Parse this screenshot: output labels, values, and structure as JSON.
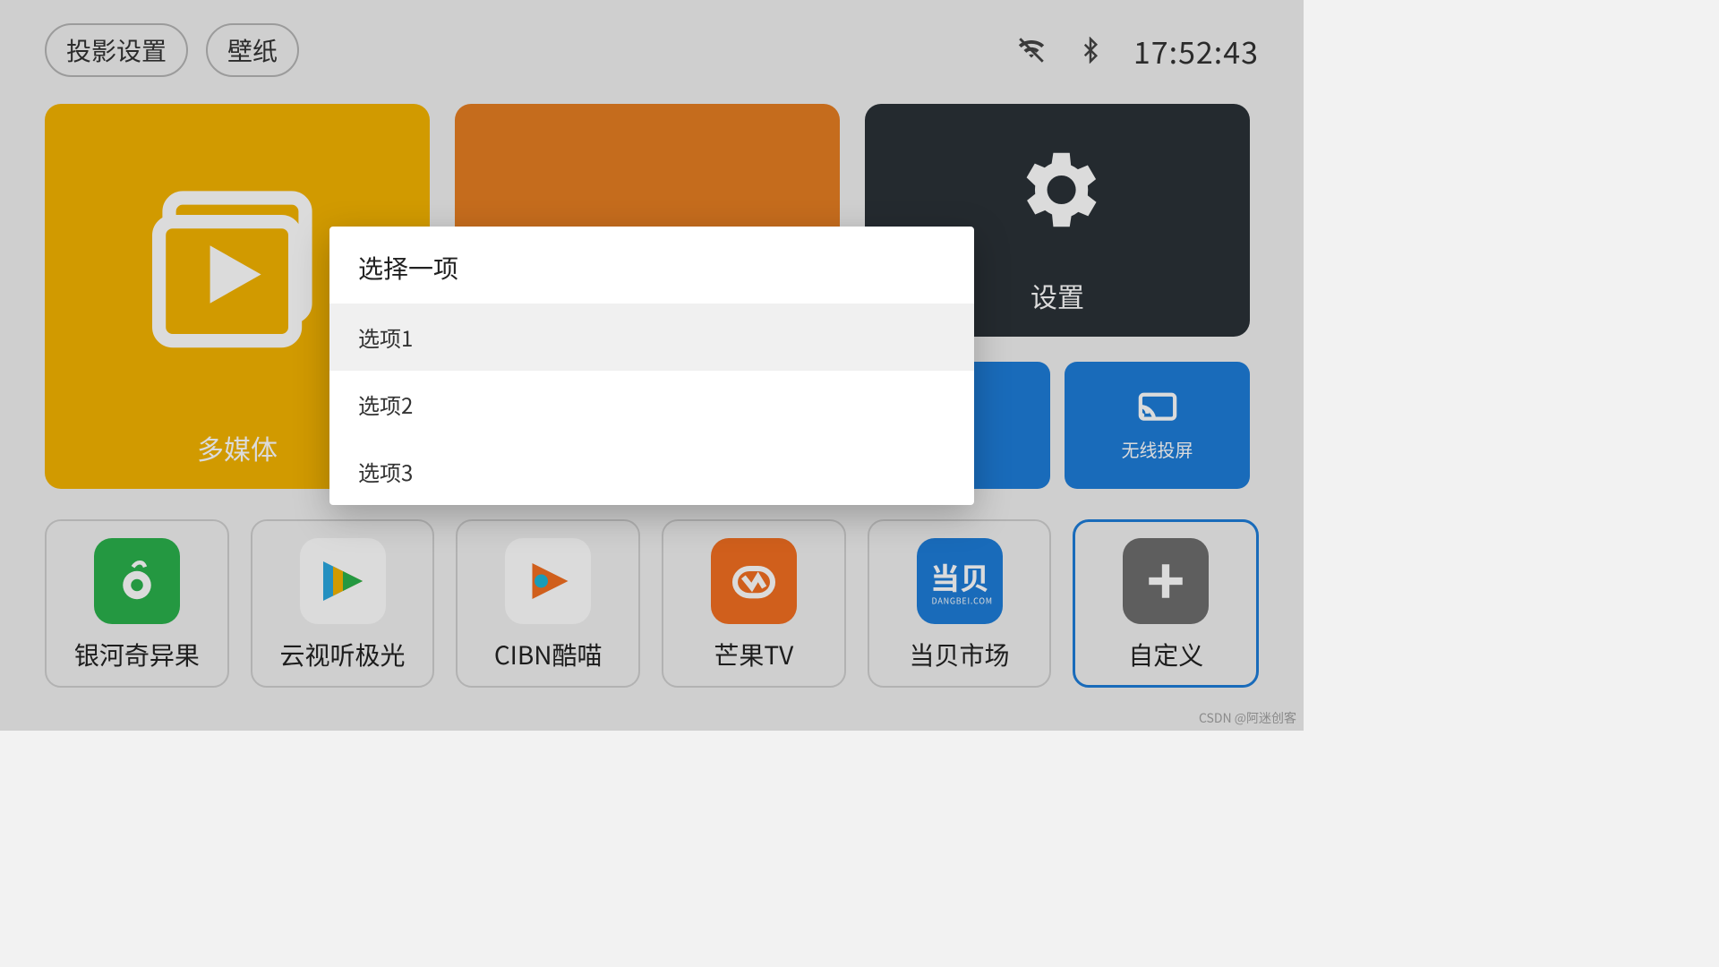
{
  "header": {
    "btn_projection": "投影设置",
    "btn_wallpaper": "壁纸",
    "clock": "17:52:43"
  },
  "tiles": {
    "media": "多媒体",
    "settings": "设置",
    "wireless_cast": "无线投屏"
  },
  "dialog": {
    "title": "选择一项",
    "items": [
      "选项1",
      "选项2",
      "选项3"
    ],
    "selected_index": 0
  },
  "apps": [
    {
      "label": "银河奇异果",
      "icon": "qiyiguo"
    },
    {
      "label": "云视听极光",
      "icon": "jiguang"
    },
    {
      "label": "CIBN酷喵",
      "icon": "kumiao"
    },
    {
      "label": "芒果TV",
      "icon": "mango"
    },
    {
      "label": "当贝市场",
      "icon": "dangbei"
    },
    {
      "label": "自定义",
      "icon": "custom",
      "focused": true
    }
  ],
  "watermark": "CSDN @阿迷创客"
}
